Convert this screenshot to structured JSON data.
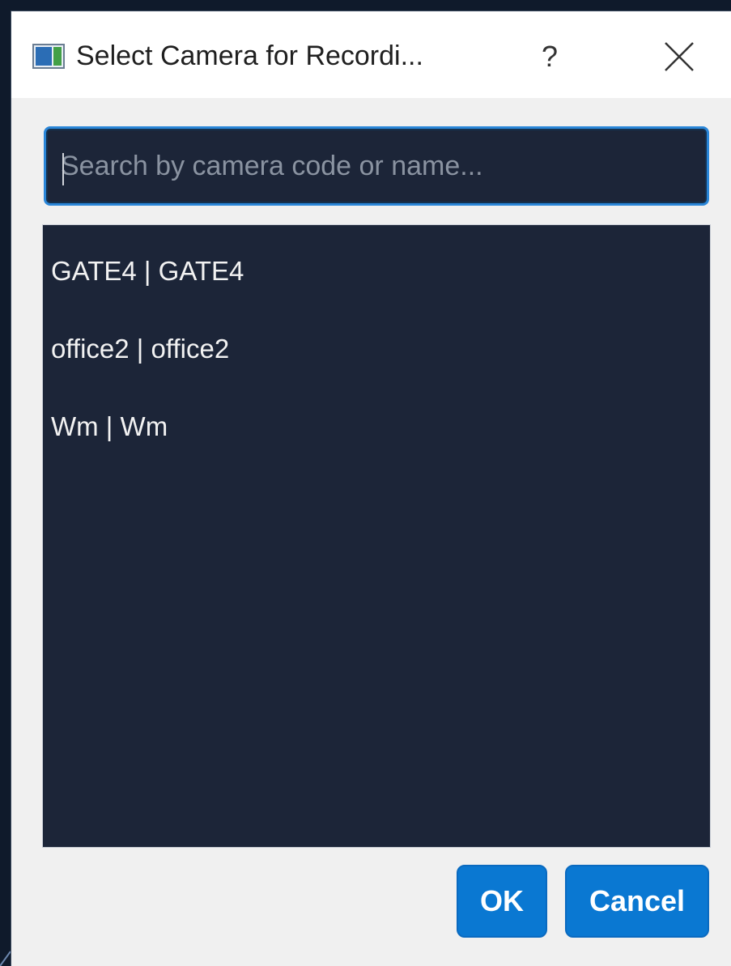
{
  "dialog": {
    "title": "Select Camera for Recordi...",
    "app_icon": "window-app-icon",
    "help_label": "?",
    "close_icon": "close-icon"
  },
  "search": {
    "value": "",
    "placeholder": "Search by camera code or name..."
  },
  "camera_list": {
    "items": [
      {
        "label": "GATE4 | GATE4"
      },
      {
        "label": "office2 | office2"
      },
      {
        "label": "Wm | Wm"
      }
    ]
  },
  "buttons": {
    "ok_label": "OK",
    "cancel_label": "Cancel"
  },
  "colors": {
    "accent": "#0a78d2",
    "panel_background": "#1c2538",
    "dialog_background": "#f0f0f0",
    "focus_border": "#2a86d8"
  }
}
